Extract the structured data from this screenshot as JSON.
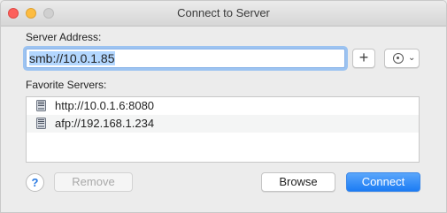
{
  "window": {
    "title": "Connect to Server"
  },
  "server_address": {
    "label": "Server Address:",
    "value": "smb://10.0.1.85"
  },
  "buttons": {
    "add": "+",
    "action_chevron": "⌄",
    "help": "?",
    "remove": "Remove",
    "browse": "Browse",
    "connect": "Connect"
  },
  "favorites": {
    "label": "Favorite Servers:",
    "items": [
      {
        "address": "http://10.0.1.6:8080",
        "icon": "server-icon"
      },
      {
        "address": "afp://192.168.1.234",
        "icon": "server-icon"
      }
    ]
  },
  "colors": {
    "accent": "#1c7cf4",
    "focus_ring": "#9cc3f1",
    "selection": "#b3d7ff"
  }
}
